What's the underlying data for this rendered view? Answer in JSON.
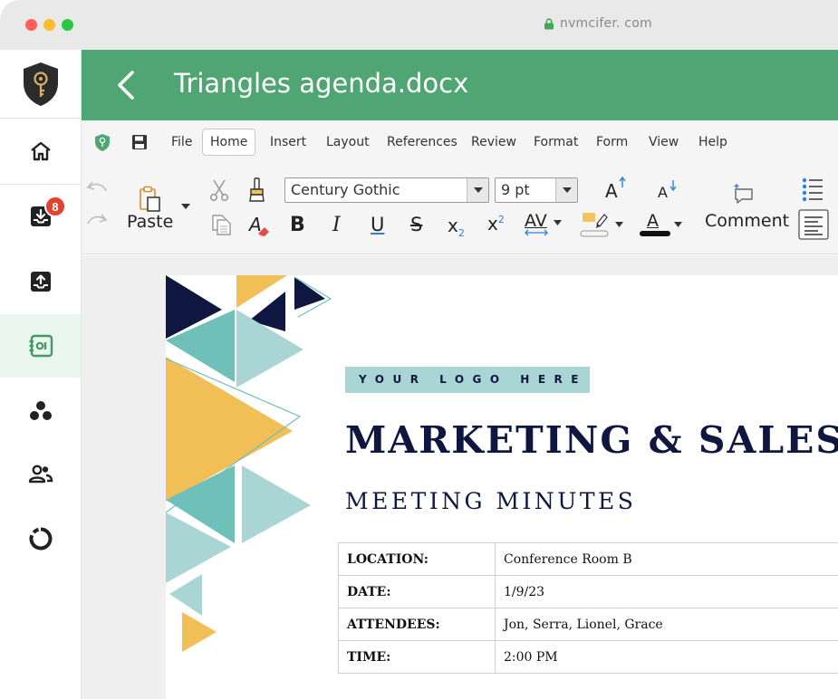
{
  "browser": {
    "url": "nvmcifer. com"
  },
  "sidebar": {
    "items": [
      {
        "name": "home",
        "badge": ""
      },
      {
        "name": "inbox",
        "badge": "8"
      },
      {
        "name": "upload",
        "badge": ""
      },
      {
        "name": "contacts",
        "badge": ""
      },
      {
        "name": "groups",
        "badge": ""
      },
      {
        "name": "users",
        "badge": ""
      },
      {
        "name": "loading",
        "badge": ""
      }
    ],
    "active": "contacts"
  },
  "titlebar": {
    "title": "Triangles agenda.docx"
  },
  "menu": {
    "items": [
      "File",
      "Home",
      "Insert",
      "Layout",
      "References",
      "Review",
      "Format",
      "Form",
      "View",
      "Help"
    ],
    "selected": "Home"
  },
  "ribbon": {
    "paste_label": "Paste",
    "font_name": "Century Gothic",
    "font_size": "9 pt",
    "comment_label": "Comment",
    "bold": "B",
    "italic": "I",
    "underline": "U",
    "strike": "S",
    "subscript": "x",
    "subscript_mark": "2",
    "superscript": "x",
    "superscript_mark": "2",
    "spacing": "AV",
    "grow": "A",
    "shrink": "A",
    "font_color": "A",
    "clear_format": "A"
  },
  "document": {
    "logo_text": "YOUR LOGO HERE",
    "heading": "MARKETING & SALES",
    "subheading": "MEETING MINUTES",
    "rows": [
      {
        "key": "LOCATION:",
        "value": "Conference Room B"
      },
      {
        "key": "DATE:",
        "value": "1/9/23"
      },
      {
        "key": "ATTENDEES:",
        "value": "Jon, Serra, Lionel, Grace"
      },
      {
        "key": "TIME:",
        "value": "2:00 PM"
      }
    ]
  },
  "colors": {
    "accent_green": "#4fa672",
    "navy": "#0f1740",
    "teal": "#6fc0b8",
    "light_teal": "#a9d6d5",
    "gold": "#f2bf56",
    "badge_red": "#e2432f"
  }
}
